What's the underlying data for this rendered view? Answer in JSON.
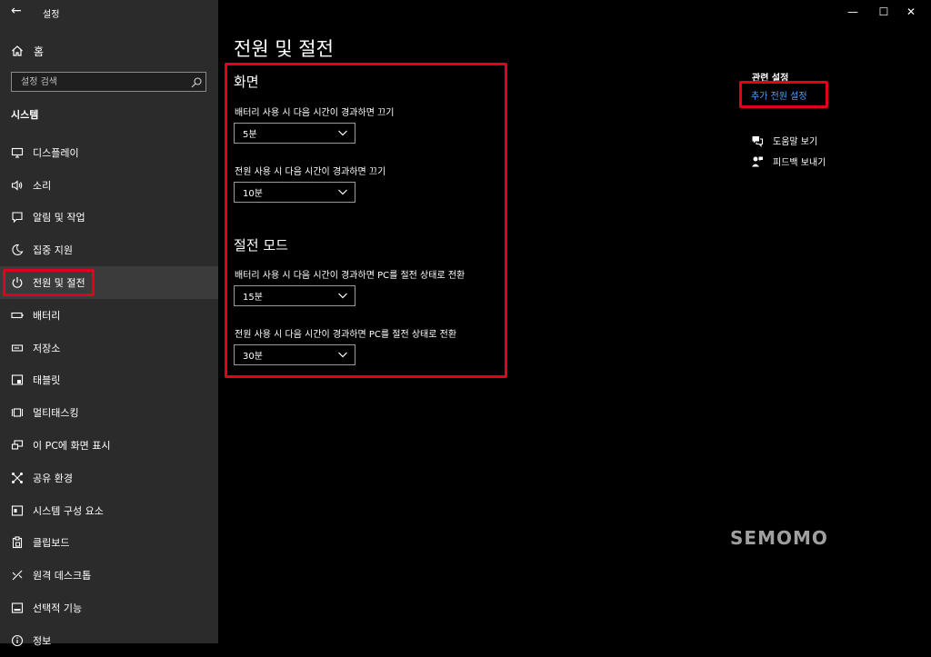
{
  "titlebar": {
    "back_glyph": "←",
    "app_title": "설정",
    "minimize_glyph": "—",
    "maximize_glyph": "☐",
    "close_glyph": "✕"
  },
  "sidebar": {
    "home_label": "홈",
    "search_placeholder": "설정 검색",
    "section_label": "시스템",
    "items": [
      {
        "label": "디스플레이",
        "icon": "display-icon"
      },
      {
        "label": "소리",
        "icon": "speaker-icon"
      },
      {
        "label": "알림 및 작업",
        "icon": "notification-icon"
      },
      {
        "label": "집중 지원",
        "icon": "moon-icon"
      },
      {
        "label": "전원 및 절전",
        "icon": "power-icon",
        "active": true
      },
      {
        "label": "배터리",
        "icon": "battery-icon"
      },
      {
        "label": "저장소",
        "icon": "storage-icon"
      },
      {
        "label": "태블릿",
        "icon": "tablet-icon"
      },
      {
        "label": "멀티태스킹",
        "icon": "multitasking-icon"
      },
      {
        "label": "이 PC에 화면 표시",
        "icon": "project-icon"
      },
      {
        "label": "공유 환경",
        "icon": "shared-experience-icon"
      },
      {
        "label": "시스템 구성 요소",
        "icon": "components-icon"
      },
      {
        "label": "클립보드",
        "icon": "clipboard-icon"
      },
      {
        "label": "원격 데스크톱",
        "icon": "remote-desktop-icon"
      },
      {
        "label": "선택적 기능",
        "icon": "optional-features-icon"
      },
      {
        "label": "정보",
        "icon": "info-icon"
      }
    ]
  },
  "main": {
    "title": "전원 및 절전",
    "screen": {
      "heading": "화면",
      "battery_label": "배터리 사용 시 다음 시간이 경과하면 끄기",
      "battery_value": "5분",
      "plugged_label": "전원 사용 시 다음 시간이 경과하면 끄기",
      "plugged_value": "10분"
    },
    "sleep": {
      "heading": "절전 모드",
      "battery_label": "배터리 사용 시 다음 시간이 경과하면 PC를 절전 상태로 전환",
      "battery_value": "15분",
      "plugged_label": "전원 사용 시 다음 시간이 경과하면 PC를 절전 상태로 전환",
      "plugged_value": "30분"
    }
  },
  "related": {
    "title": "관련 설정",
    "additional_power_link": "추가 전원 설정",
    "help_label": "도움말 보기",
    "feedback_label": "피드백 보내기"
  },
  "watermark": "SEMOMO",
  "colors": {
    "highlight_red": "#e3001b",
    "link_blue": "#4aa3ff",
    "sidebar_bg": "#2b2b2b",
    "main_bg": "#000000"
  }
}
